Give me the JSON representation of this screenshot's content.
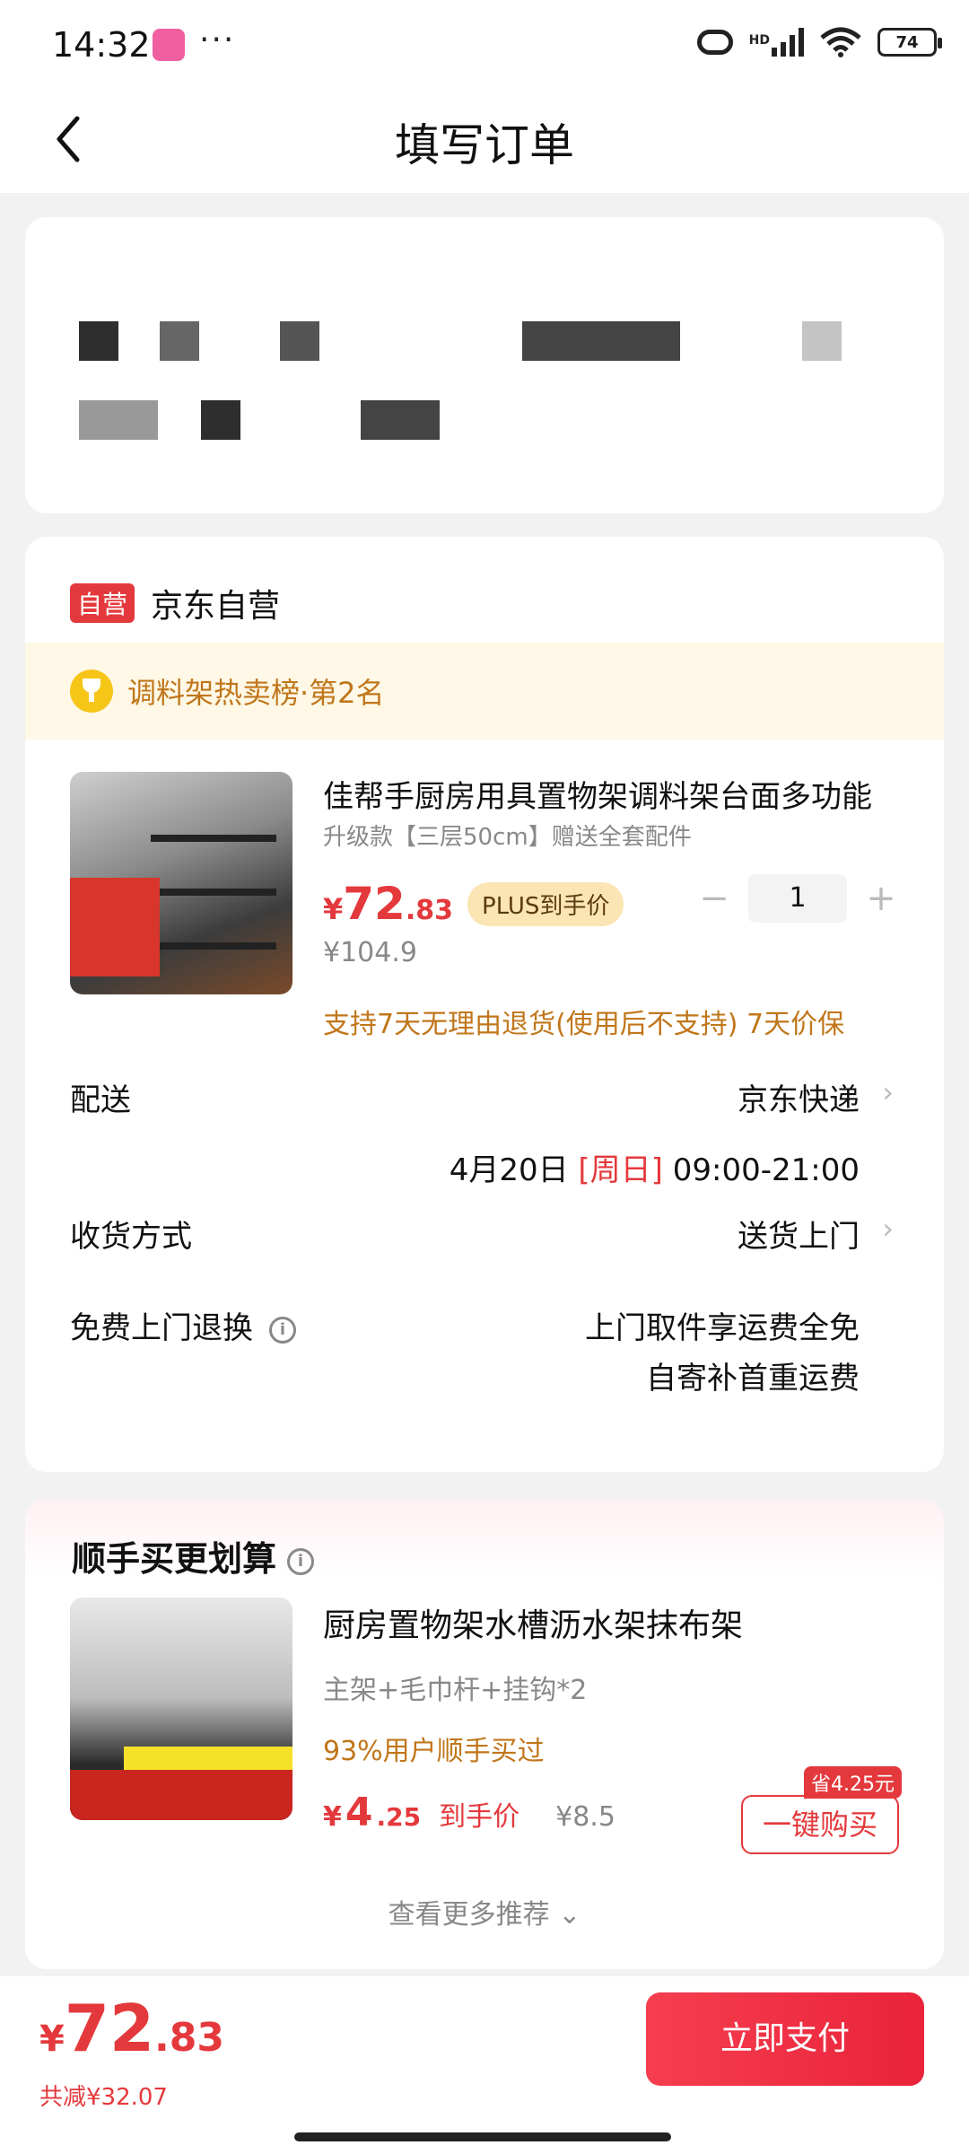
{
  "status_bar": {
    "time": "14:32",
    "more": "···",
    "hd": "HD",
    "battery": "74"
  },
  "header": {
    "title": "填写订单"
  },
  "store": {
    "tag": "自营",
    "name": "京东自营"
  },
  "rank": {
    "text": "调料架热卖榜·第2名"
  },
  "product": {
    "title": "佳帮手厨房用具置物架调料架台面多功能",
    "spec": "升级款【三层50cm】赠送全套配件",
    "price_symbol": "¥",
    "price_int": "72",
    "price_dec": ".83",
    "plus_tag": "PLUS到手价",
    "orig_price": "¥104.9",
    "quantity": "1",
    "minus": "−",
    "plus": "+",
    "service": "支持7天无理由退货(使用后不支持)  7天价保"
  },
  "delivery": {
    "label": "配送",
    "carrier": "京东快递",
    "date": "4月20日",
    "day": "[周日]",
    "window": "09:00-21:00"
  },
  "receive": {
    "label": "收货方式",
    "value": "送货上门"
  },
  "returns": {
    "label": "免费上门退换",
    "line1": "上门取件享运费全免",
    "line2": "自寄补首重运费"
  },
  "recommend": {
    "title": "顺手买更划算",
    "name": "厨房置物架水槽沥水架抹布架",
    "spec": "主架+毛巾杆+挂钩*2",
    "pct": "93%用户顺手买过",
    "price_symbol": "¥",
    "price_int": "4",
    "price_dec": ".25",
    "price_label": "到手价",
    "orig_price": "¥8.5",
    "save_tag": "省4.25元",
    "buy_button": "一键购买",
    "more": "查看更多推荐 ⌄"
  },
  "bottom": {
    "total_symbol": "¥",
    "total_int": "72",
    "total_dec": ".83",
    "discount": "共减¥32.07",
    "pay_button": "立即支付"
  },
  "colors": {
    "accent": "#e4393c",
    "gold": "#c0761a",
    "rank_bg": "#fff8e6"
  }
}
